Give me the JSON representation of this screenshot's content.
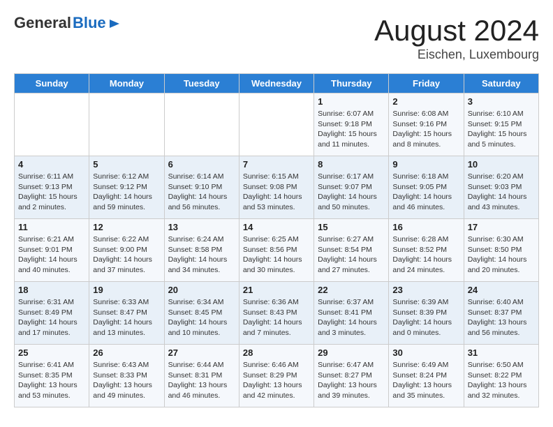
{
  "logo": {
    "general": "General",
    "blue": "Blue"
  },
  "title": "August 2024",
  "subtitle": "Eischen, Luxembourg",
  "days_of_week": [
    "Sunday",
    "Monday",
    "Tuesday",
    "Wednesday",
    "Thursday",
    "Friday",
    "Saturday"
  ],
  "weeks": [
    [
      {
        "day": "",
        "info": ""
      },
      {
        "day": "",
        "info": ""
      },
      {
        "day": "",
        "info": ""
      },
      {
        "day": "",
        "info": ""
      },
      {
        "day": "1",
        "info": "Sunrise: 6:07 AM\nSunset: 9:18 PM\nDaylight: 15 hours and 11 minutes."
      },
      {
        "day": "2",
        "info": "Sunrise: 6:08 AM\nSunset: 9:16 PM\nDaylight: 15 hours and 8 minutes."
      },
      {
        "day": "3",
        "info": "Sunrise: 6:10 AM\nSunset: 9:15 PM\nDaylight: 15 hours and 5 minutes."
      }
    ],
    [
      {
        "day": "4",
        "info": "Sunrise: 6:11 AM\nSunset: 9:13 PM\nDaylight: 15 hours and 2 minutes."
      },
      {
        "day": "5",
        "info": "Sunrise: 6:12 AM\nSunset: 9:12 PM\nDaylight: 14 hours and 59 minutes."
      },
      {
        "day": "6",
        "info": "Sunrise: 6:14 AM\nSunset: 9:10 PM\nDaylight: 14 hours and 56 minutes."
      },
      {
        "day": "7",
        "info": "Sunrise: 6:15 AM\nSunset: 9:08 PM\nDaylight: 14 hours and 53 minutes."
      },
      {
        "day": "8",
        "info": "Sunrise: 6:17 AM\nSunset: 9:07 PM\nDaylight: 14 hours and 50 minutes."
      },
      {
        "day": "9",
        "info": "Sunrise: 6:18 AM\nSunset: 9:05 PM\nDaylight: 14 hours and 46 minutes."
      },
      {
        "day": "10",
        "info": "Sunrise: 6:20 AM\nSunset: 9:03 PM\nDaylight: 14 hours and 43 minutes."
      }
    ],
    [
      {
        "day": "11",
        "info": "Sunrise: 6:21 AM\nSunset: 9:01 PM\nDaylight: 14 hours and 40 minutes."
      },
      {
        "day": "12",
        "info": "Sunrise: 6:22 AM\nSunset: 9:00 PM\nDaylight: 14 hours and 37 minutes."
      },
      {
        "day": "13",
        "info": "Sunrise: 6:24 AM\nSunset: 8:58 PM\nDaylight: 14 hours and 34 minutes."
      },
      {
        "day": "14",
        "info": "Sunrise: 6:25 AM\nSunset: 8:56 PM\nDaylight: 14 hours and 30 minutes."
      },
      {
        "day": "15",
        "info": "Sunrise: 6:27 AM\nSunset: 8:54 PM\nDaylight: 14 hours and 27 minutes."
      },
      {
        "day": "16",
        "info": "Sunrise: 6:28 AM\nSunset: 8:52 PM\nDaylight: 14 hours and 24 minutes."
      },
      {
        "day": "17",
        "info": "Sunrise: 6:30 AM\nSunset: 8:50 PM\nDaylight: 14 hours and 20 minutes."
      }
    ],
    [
      {
        "day": "18",
        "info": "Sunrise: 6:31 AM\nSunset: 8:49 PM\nDaylight: 14 hours and 17 minutes."
      },
      {
        "day": "19",
        "info": "Sunrise: 6:33 AM\nSunset: 8:47 PM\nDaylight: 14 hours and 13 minutes."
      },
      {
        "day": "20",
        "info": "Sunrise: 6:34 AM\nSunset: 8:45 PM\nDaylight: 14 hours and 10 minutes."
      },
      {
        "day": "21",
        "info": "Sunrise: 6:36 AM\nSunset: 8:43 PM\nDaylight: 14 hours and 7 minutes."
      },
      {
        "day": "22",
        "info": "Sunrise: 6:37 AM\nSunset: 8:41 PM\nDaylight: 14 hours and 3 minutes."
      },
      {
        "day": "23",
        "info": "Sunrise: 6:39 AM\nSunset: 8:39 PM\nDaylight: 14 hours and 0 minutes."
      },
      {
        "day": "24",
        "info": "Sunrise: 6:40 AM\nSunset: 8:37 PM\nDaylight: 13 hours and 56 minutes."
      }
    ],
    [
      {
        "day": "25",
        "info": "Sunrise: 6:41 AM\nSunset: 8:35 PM\nDaylight: 13 hours and 53 minutes."
      },
      {
        "day": "26",
        "info": "Sunrise: 6:43 AM\nSunset: 8:33 PM\nDaylight: 13 hours and 49 minutes."
      },
      {
        "day": "27",
        "info": "Sunrise: 6:44 AM\nSunset: 8:31 PM\nDaylight: 13 hours and 46 minutes."
      },
      {
        "day": "28",
        "info": "Sunrise: 6:46 AM\nSunset: 8:29 PM\nDaylight: 13 hours and 42 minutes."
      },
      {
        "day": "29",
        "info": "Sunrise: 6:47 AM\nSunset: 8:27 PM\nDaylight: 13 hours and 39 minutes."
      },
      {
        "day": "30",
        "info": "Sunrise: 6:49 AM\nSunset: 8:24 PM\nDaylight: 13 hours and 35 minutes."
      },
      {
        "day": "31",
        "info": "Sunrise: 6:50 AM\nSunset: 8:22 PM\nDaylight: 13 hours and 32 minutes."
      }
    ]
  ]
}
